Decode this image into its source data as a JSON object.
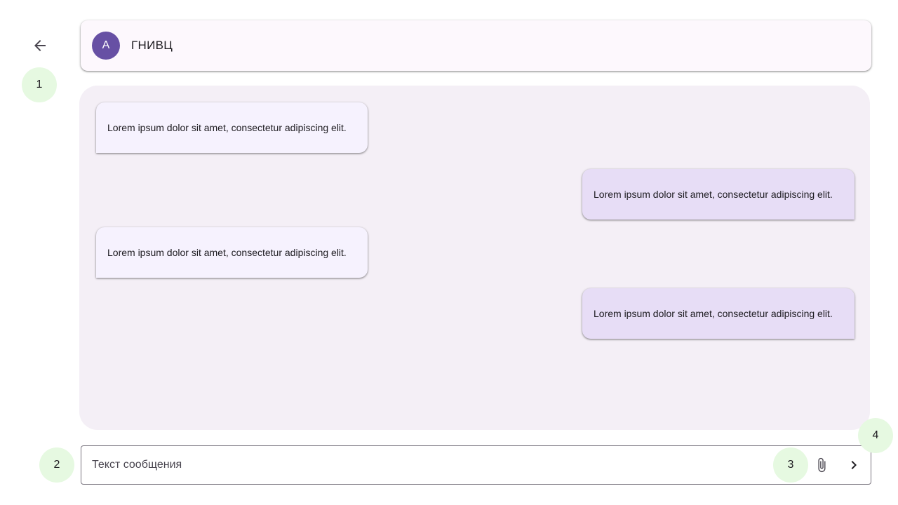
{
  "header": {
    "avatar_letter": "А",
    "chat_title": "ГНИВЦ"
  },
  "messages": [
    {
      "direction": "incoming",
      "text": "Lorem ipsum dolor sit amet, consectetur adipiscing elit."
    },
    {
      "direction": "outgoing",
      "text": "Lorem ipsum dolor sit amet, consectetur adipiscing elit."
    },
    {
      "direction": "incoming",
      "text": "Lorem ipsum dolor sit amet, consectetur adipiscing elit."
    },
    {
      "direction": "outgoing",
      "text": "Lorem ipsum dolor sit amet, consectetur adipiscing elit."
    }
  ],
  "composer": {
    "placeholder": "Текст сообщения",
    "value": ""
  },
  "markers": [
    "1",
    "2",
    "3",
    "4"
  ],
  "icons": {
    "back": "arrow-back-icon",
    "attach": "paperclip-icon",
    "send": "chevron-right-icon"
  },
  "colors": {
    "accent": "#6750a4",
    "chat_background": "#f4eff6",
    "incoming_bubble": "#f6f2fe",
    "outgoing_bubble": "#e7ddf6",
    "marker_background": "#e6f9e1"
  }
}
